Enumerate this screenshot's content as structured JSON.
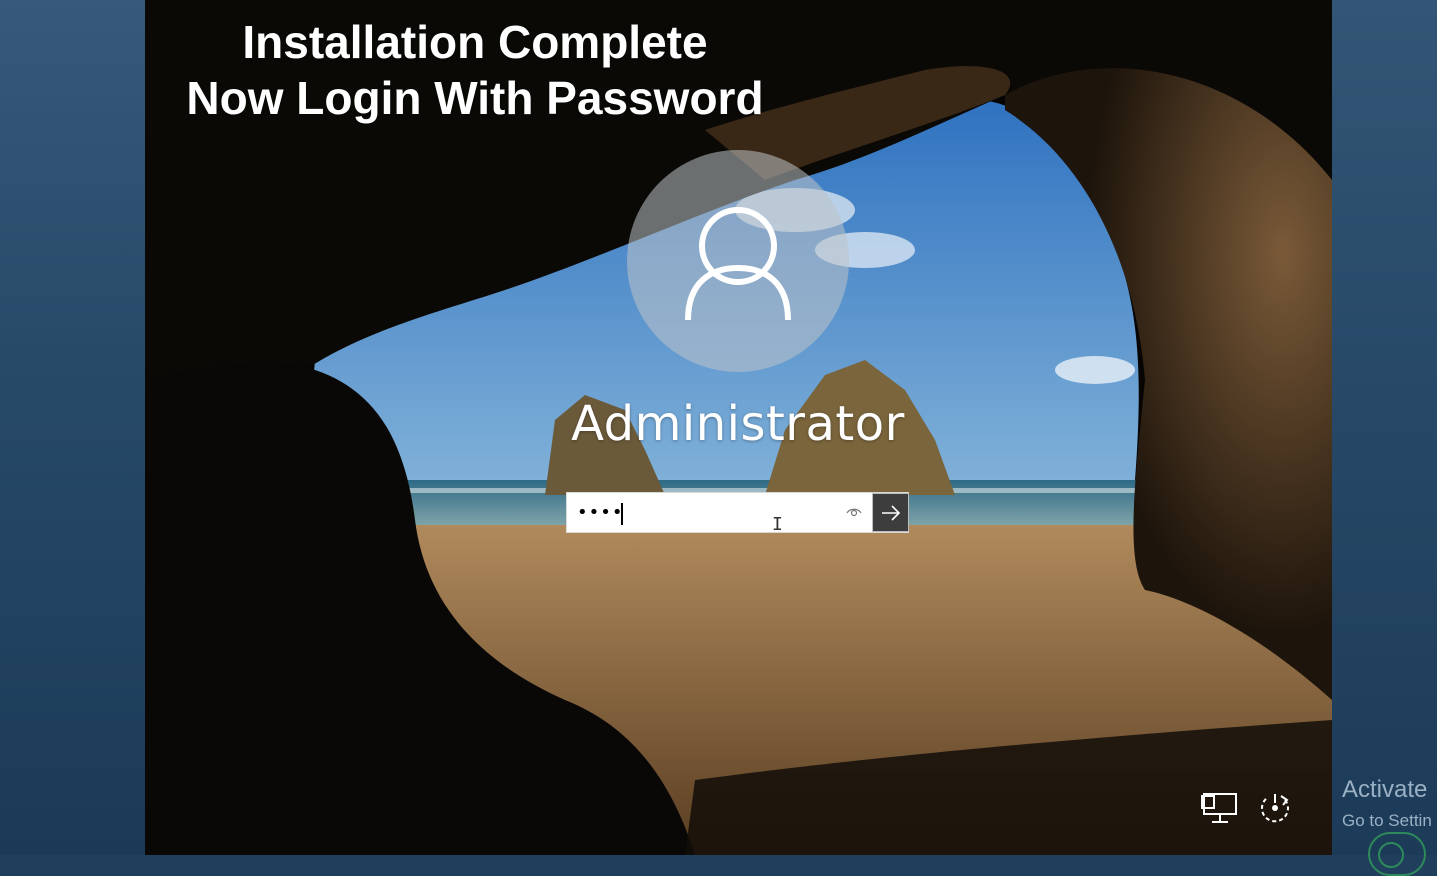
{
  "overlay": {
    "line1": "Installation Complete",
    "line2": "Now Login With Password"
  },
  "login": {
    "user_icon": "user-avatar-icon",
    "username": "Administrator",
    "password_masked": "••••",
    "reveal_icon": "eye-icon",
    "submit_icon": "arrow-right-icon"
  },
  "system_icons": {
    "network": "network-icon",
    "ease_of_access": "ease-of-access-icon"
  },
  "watermark": {
    "title": "Activate",
    "subtitle": "Go to Settin"
  },
  "colors": {
    "sky": "#3c80c8",
    "sea": "#2d6d8a",
    "sand": "#a07a50",
    "rock": "#2b1d10",
    "submit_bg": "#3d3d3d",
    "side_panel": "#274968"
  }
}
